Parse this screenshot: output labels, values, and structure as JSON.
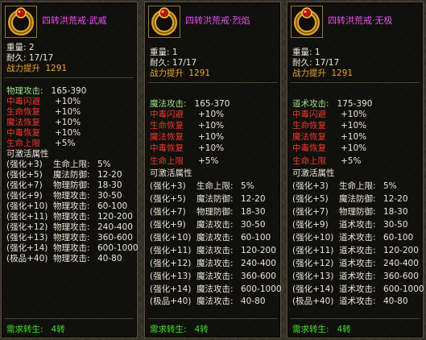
{
  "items": [
    {
      "name": "四转洪荒戒·武威",
      "weight_label": "重量:",
      "weight": "2",
      "durability_label": "耐久:",
      "durability": "17/17",
      "power_label": "战力提升",
      "power": "1291",
      "main_stat": {
        "label": "物理攻击:",
        "value": "165-390"
      },
      "bonuses": [
        {
          "label": "中毒闪避",
          "value": "+10%"
        },
        {
          "label": "生命恢复",
          "value": "+10%"
        },
        {
          "label": "魔法恢复",
          "value": "+10%"
        },
        {
          "label": "中毒恢复",
          "value": "+10%"
        },
        {
          "label": "生命上限",
          "value": "+5%"
        }
      ],
      "activatable_title": "可激活属性",
      "enhance": [
        {
          "level": "(强化+3)",
          "attr": "生命上限:",
          "value": "5%"
        },
        {
          "level": "(强化+5)",
          "attr": "魔法防御:",
          "value": "12-20"
        },
        {
          "level": "(强化+7)",
          "attr": "物理防御:",
          "value": "18-30"
        },
        {
          "level": "(强化+9)",
          "attr": "物理攻击:",
          "value": "30-50"
        },
        {
          "level": "(强化+10)",
          "attr": "物理攻击:",
          "value": "60-100"
        },
        {
          "level": "(强化+11)",
          "attr": "物理攻击:",
          "value": "120-200"
        },
        {
          "level": "(强化+12)",
          "attr": "物理攻击:",
          "value": "240-400"
        },
        {
          "level": "(强化+13)",
          "attr": "物理攻击:",
          "value": "360-600"
        },
        {
          "level": "(强化+14)",
          "attr": "物理攻击:",
          "value": "600-1000"
        },
        {
          "level": "(极品+40)",
          "attr": "物理攻击:",
          "value": "40-80"
        }
      ],
      "requirement_label": "需求转生:",
      "requirement": "4转"
    },
    {
      "name": "四转洪荒戒·烈焰",
      "weight_label": "重量:",
      "weight": "1",
      "durability_label": "耐久:",
      "durability": "17/17",
      "power_label": "战力提升",
      "power": "1291",
      "main_stat": {
        "label": "魔法攻击:",
        "value": "165-370"
      },
      "bonuses": [
        {
          "label": "中毒闪避",
          "value": "+10%"
        },
        {
          "label": "生命恢复",
          "value": "+10%"
        },
        {
          "label": "魔法恢复",
          "value": "+10%"
        },
        {
          "label": "中毒恢复",
          "value": "+10%"
        },
        {
          "label": "生命上限",
          "value": "+5%"
        }
      ],
      "activatable_title": "可激活属性",
      "enhance": [
        {
          "level": "(强化+3)",
          "attr": "生命上限:",
          "value": "5%"
        },
        {
          "level": "(强化+5)",
          "attr": "魔法防御:",
          "value": "12-20"
        },
        {
          "level": "(强化+7)",
          "attr": "物理防御:",
          "value": "18-30"
        },
        {
          "level": "(强化+9)",
          "attr": "魔法攻击:",
          "value": "30-50"
        },
        {
          "level": "(强化+10)",
          "attr": "魔法攻击:",
          "value": "60-100"
        },
        {
          "level": "(强化+11)",
          "attr": "魔法攻击:",
          "value": "120-200"
        },
        {
          "level": "(强化+12)",
          "attr": "魔法攻击:",
          "value": "240-400"
        },
        {
          "level": "(强化+13)",
          "attr": "魔法攻击:",
          "value": "360-600"
        },
        {
          "level": "(强化+14)",
          "attr": "魔法攻击:",
          "value": "600-1000"
        },
        {
          "level": "(极品+40)",
          "attr": "魔法攻击:",
          "value": "40-80"
        }
      ],
      "requirement_label": "需求转生:",
      "requirement": "4转"
    },
    {
      "name": "四转洪荒戒·无极",
      "weight_label": "重量:",
      "weight": "1",
      "durability_label": "耐久:",
      "durability": "17/17",
      "power_label": "战力提升",
      "power": "1291",
      "main_stat": {
        "label": "道术攻击:",
        "value": "175-390"
      },
      "bonuses": [
        {
          "label": "中毒闪避",
          "value": "+10%"
        },
        {
          "label": "生命恢复",
          "value": "+10%"
        },
        {
          "label": "魔法恢复",
          "value": "+10%"
        },
        {
          "label": "中毒恢复",
          "value": "+10%"
        },
        {
          "label": "生命上限",
          "value": "+5%"
        }
      ],
      "activatable_title": "可激活属性",
      "enhance": [
        {
          "level": "(强化+3)",
          "attr": "生命上限:",
          "value": "5%"
        },
        {
          "level": "(强化+5)",
          "attr": "魔法防御:",
          "value": "12-20"
        },
        {
          "level": "(强化+7)",
          "attr": "物理防御:",
          "value": "18-30"
        },
        {
          "level": "(强化+9)",
          "attr": "道术攻击:",
          "value": "30-50"
        },
        {
          "level": "(强化+10)",
          "attr": "道术攻击:",
          "value": "60-100"
        },
        {
          "level": "(强化+11)",
          "attr": "道术攻击:",
          "value": "120-200"
        },
        {
          "level": "(强化+12)",
          "attr": "道术攻击:",
          "value": "240-400"
        },
        {
          "level": "(强化+13)",
          "attr": "道术攻击:",
          "value": "360-600"
        },
        {
          "level": "(强化+14)",
          "attr": "道术攻击:",
          "value": "600-1000"
        },
        {
          "level": "(极品+40)",
          "attr": "道术攻击:",
          "value": "40-80"
        }
      ],
      "requirement_label": "需求转生:",
      "requirement": "4转"
    }
  ],
  "colors": {
    "item_name": "#ea52f0",
    "power": "#eea52e",
    "main_stat": "#9fe089",
    "bonus": "#ee3a2e",
    "requirement": "#3ee22a",
    "text": "#ece6d8"
  },
  "icon_name": "ring-icon"
}
